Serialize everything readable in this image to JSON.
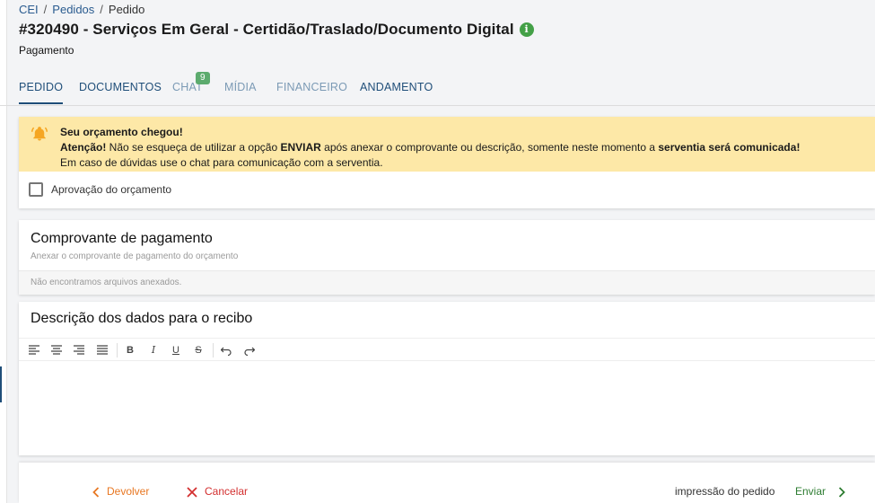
{
  "breadcrumb": {
    "items": [
      "CEI",
      "Pedidos",
      "Pedido"
    ]
  },
  "header": {
    "title": "#320490 - Serviços Em Geral - Certidão/Traslado/Documento Digital",
    "subtitle": "Pagamento"
  },
  "tabs": [
    {
      "label": "PEDIDO",
      "state": "active"
    },
    {
      "label": "DOCUMENTOS",
      "state": "normal"
    },
    {
      "label": "CHAT",
      "state": "disabled",
      "badge": "9"
    },
    {
      "label": "MÍDIA",
      "state": "disabled"
    },
    {
      "label": "FINANCEIRO",
      "state": "disabled"
    },
    {
      "label": "ANDAMENTO",
      "state": "normal"
    }
  ],
  "alert": {
    "title": "Seu orçamento chegou!",
    "line2_strong1": "Atenção!",
    "line2_text1": " Não se esqueça de utilizar a opção ",
    "line2_strong2": "ENVIAR",
    "line2_text2": " após anexar o comprovante ou descrição, somente neste momento a ",
    "line2_strong3": "serventia será comunicada!",
    "line3": "Em caso de dúvidas use o chat para comunicação com a serventia.",
    "icon": "bell-icon",
    "bg_color": "#fde8a7"
  },
  "approval": {
    "label": "Aprovação do orçamento",
    "checked": false
  },
  "receipt": {
    "title": "Comprovante de pagamento",
    "subtitle": "Anexar o comprovante de pagamento do orçamento",
    "empty": "Não encontramos arquivos anexados."
  },
  "description": {
    "title": "Descrição dos dados para o recibo",
    "toolbar": [
      "align-left-icon",
      "align-center-icon",
      "align-right-icon",
      "align-justify-icon",
      "bold-icon",
      "italic-icon",
      "underline-icon",
      "strikethrough-icon",
      "undo-icon",
      "redo-icon"
    ]
  },
  "footer": {
    "devolver": "Devolver",
    "cancelar": "Cancelar",
    "impressao": "impressão do pedido",
    "enviar": "Enviar"
  },
  "colors": {
    "primary": "#1f4e79",
    "success": "#43a047",
    "warning": "#e87722",
    "danger": "#d32f2f"
  }
}
